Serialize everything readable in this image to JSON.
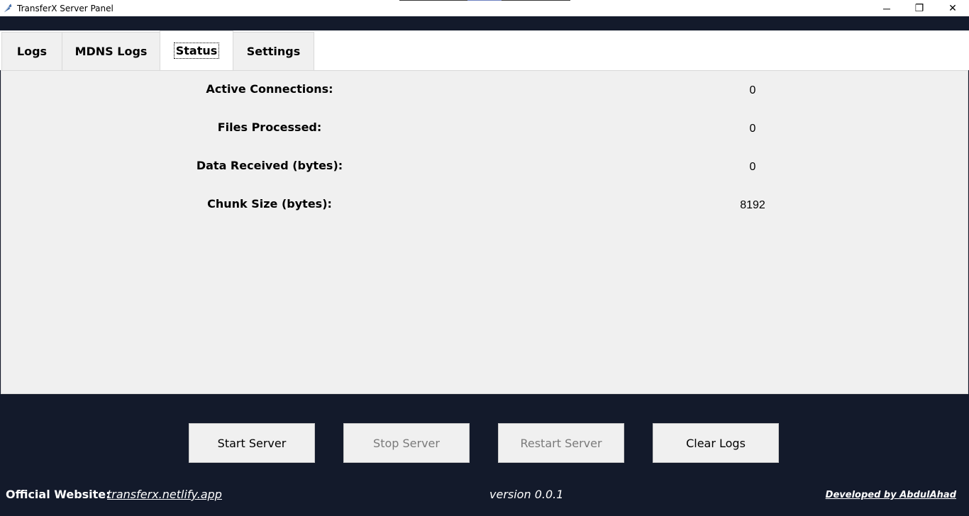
{
  "window": {
    "title": "TransferX Server Panel",
    "app_icon": "feather-icon",
    "controls": {
      "minimize": "─",
      "maximize": "❐",
      "close": "✕"
    }
  },
  "tabs": [
    {
      "label": "Logs",
      "active": false
    },
    {
      "label": "MDNS Logs",
      "active": false
    },
    {
      "label": "Status",
      "active": true
    },
    {
      "label": "Settings",
      "active": false
    }
  ],
  "status": {
    "rows": [
      {
        "label": "Active Connections:",
        "value": "0"
      },
      {
        "label": "Files Processed:",
        "value": "0"
      },
      {
        "label": "Data Received (bytes):",
        "value": "0"
      },
      {
        "label": "Chunk Size (bytes):",
        "value": "8192"
      }
    ]
  },
  "controls": {
    "start": {
      "label": "Start Server",
      "enabled": true
    },
    "stop": {
      "label": "Stop Server",
      "enabled": false
    },
    "restart": {
      "label": "Restart Server",
      "enabled": false
    },
    "clear": {
      "label": "Clear Logs",
      "enabled": true
    }
  },
  "footer": {
    "website_label": "Official Website:",
    "website_link": "transferx.netlify.app",
    "version": "version 0.0.1",
    "developer": "Developed by AbdulAhad"
  },
  "colors": {
    "background_dark": "#131a2b",
    "panel_bg": "#f0f0f0",
    "disabled_text": "#7a7a7a"
  }
}
